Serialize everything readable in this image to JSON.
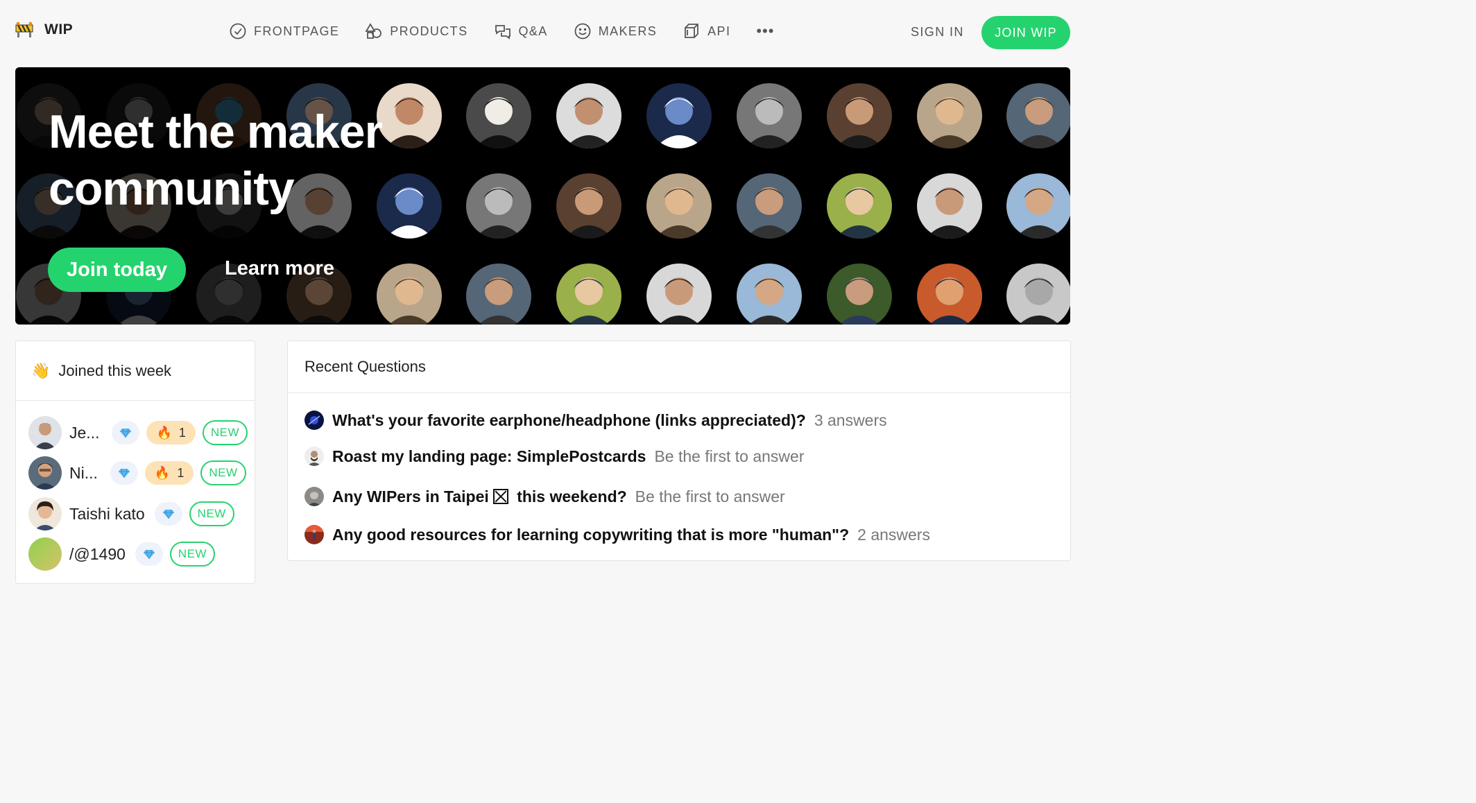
{
  "brand": {
    "name": "WIP"
  },
  "nav": {
    "links": [
      {
        "label": "FRONTPAGE",
        "icon": "check-circle-icon"
      },
      {
        "label": "PRODUCTS",
        "icon": "shapes-icon"
      },
      {
        "label": "Q&A",
        "icon": "chat-bubbles-icon"
      },
      {
        "label": "MAKERS",
        "icon": "smiley-icon"
      },
      {
        "label": "API",
        "icon": "cube-icon"
      }
    ],
    "more": "•••",
    "sign_in": "SIGN IN",
    "join": "JOIN WIP"
  },
  "hero": {
    "title_line1": "Meet the maker",
    "title_line2": "community",
    "join_today": "Join today",
    "learn_more": "Learn more"
  },
  "joined": {
    "emoji": "👋",
    "title": "Joined this week",
    "members": [
      {
        "name": "Je...",
        "streak": "1",
        "badge": "NEW"
      },
      {
        "name": "Ni...",
        "streak": "1",
        "badge": "NEW"
      },
      {
        "name": "Taishi kato",
        "badge": "NEW"
      },
      {
        "name": "/@1490",
        "badge": "NEW"
      }
    ]
  },
  "questions": {
    "title": "Recent Questions",
    "items": [
      {
        "text": "What's your favorite earphone/headphone (links appreciated)?",
        "status": "3 answers"
      },
      {
        "text": "Roast my landing page: SimplePostcards",
        "status": "Be the first to answer"
      },
      {
        "text_a": "Any WIPers in Taipei",
        "text_b": "this weekend?",
        "status": "Be the first to answer"
      },
      {
        "text": "Any good resources for learning copywriting that is more \"human\"?",
        "status": "2 answers"
      }
    ]
  },
  "colors": {
    "accent": "#25d36e",
    "hero_bg": "#000000",
    "page_bg": "#f7f7f7"
  }
}
